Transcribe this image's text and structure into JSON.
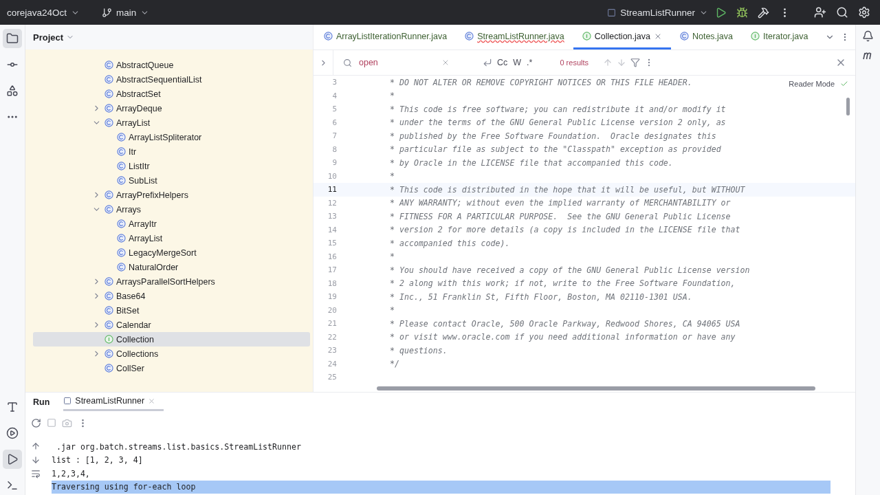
{
  "title_bar": {
    "project": "corejava24Oct",
    "branch": "main",
    "run_config": "StreamListRunner"
  },
  "project_panel": {
    "title": "Project",
    "tree": [
      {
        "label": "AbstractQueue",
        "kind": "class",
        "selected": false
      },
      {
        "label": "AbstractSequentialList",
        "kind": "class",
        "selected": false
      },
      {
        "label": "AbstractSet",
        "kind": "class",
        "selected": false
      },
      {
        "label": "ArrayDeque",
        "kind": "class",
        "selected": false,
        "expanded": false
      },
      {
        "label": "ArrayList",
        "kind": "class",
        "selected": false,
        "expanded": true,
        "children": [
          {
            "label": "ArrayListSpliterator",
            "kind": "class",
            "selected": false
          },
          {
            "label": "Itr",
            "kind": "class",
            "selected": false
          },
          {
            "label": "ListItr",
            "kind": "class",
            "selected": false
          },
          {
            "label": "SubList",
            "kind": "class",
            "selected": false
          }
        ]
      },
      {
        "label": "ArrayPrefixHelpers",
        "kind": "class",
        "selected": false,
        "expanded": false
      },
      {
        "label": "Arrays",
        "kind": "class",
        "selected": false,
        "expanded": true,
        "children": [
          {
            "label": "ArrayItr",
            "kind": "class",
            "selected": false
          },
          {
            "label": "ArrayList",
            "kind": "class",
            "selected": false
          },
          {
            "label": "LegacyMergeSort",
            "kind": "class",
            "selected": false
          },
          {
            "label": "NaturalOrder",
            "kind": "class",
            "selected": false
          }
        ]
      },
      {
        "label": "ArraysParallelSortHelpers",
        "kind": "class",
        "selected": false,
        "expanded": false
      },
      {
        "label": "Base64",
        "kind": "class",
        "selected": false,
        "expanded": false
      },
      {
        "label": "BitSet",
        "kind": "class",
        "selected": false
      },
      {
        "label": "Calendar",
        "kind": "class",
        "selected": false,
        "expanded": false
      },
      {
        "label": "Collection",
        "kind": "interface",
        "selected": true
      },
      {
        "label": "Collections",
        "kind": "class",
        "selected": false,
        "expanded": false
      },
      {
        "label": "CollSer",
        "kind": "class",
        "selected": false
      }
    ]
  },
  "editor_tabs": [
    {
      "label": "ArrayListIterationRunner.java",
      "kind": "class",
      "selected": false,
      "error": false
    },
    {
      "label": "StreamListRunner.java",
      "kind": "class",
      "selected": false,
      "error": true
    },
    {
      "label": "Collection.java",
      "kind": "interface",
      "selected": true,
      "error": false
    },
    {
      "label": "Notes.java",
      "kind": "class",
      "selected": false,
      "error": false
    },
    {
      "label": "Iterator.java",
      "kind": "interface",
      "selected": false,
      "error": false
    }
  ],
  "find_bar": {
    "value": "open",
    "options": [
      "Cc",
      "W",
      ".*"
    ],
    "results": "0 results"
  },
  "reader_mode": "Reader Mode",
  "code_lines": [
    {
      "number": "3",
      "text": "* DO NOT ALTER OR REMOVE COPYRIGHT NOTICES OR THIS FILE HEADER.",
      "current": false
    },
    {
      "number": "4",
      "text": "*",
      "current": false
    },
    {
      "number": "5",
      "text": "* This code is free software; you can redistribute it and/or modify it",
      "current": false
    },
    {
      "number": "6",
      "text": "* under the terms of the GNU General Public License version 2 only, as",
      "current": false
    },
    {
      "number": "7",
      "text": "* published by the Free Software Foundation.  Oracle designates this",
      "current": false
    },
    {
      "number": "8",
      "text": "* particular file as subject to the \"Classpath\" exception as provided",
      "current": false
    },
    {
      "number": "9",
      "text": "* by Oracle in the LICENSE file that accompanied this code.",
      "current": false
    },
    {
      "number": "10",
      "text": "*",
      "current": false
    },
    {
      "number": "11",
      "text": "* This code is distributed in the hope that it will be useful, but WITHOUT",
      "current": true
    },
    {
      "number": "12",
      "text": "* ANY WARRANTY; without even the implied warranty of MERCHANTABILITY or",
      "current": false
    },
    {
      "number": "13",
      "text": "* FITNESS FOR A PARTICULAR PURPOSE.  See the GNU General Public License",
      "current": false
    },
    {
      "number": "14",
      "text": "* version 2 for more details (a copy is included in the LICENSE file that",
      "current": false
    },
    {
      "number": "15",
      "text": "* accompanied this code).",
      "current": false
    },
    {
      "number": "16",
      "text": "*",
      "current": false
    },
    {
      "number": "17",
      "text": "* You should have received a copy of the GNU General Public License version",
      "current": false
    },
    {
      "number": "18",
      "text": "* 2 along with this work; if not, write to the Free Software Foundation,",
      "current": false
    },
    {
      "number": "19",
      "text": "* Inc., 51 Franklin St, Fifth Floor, Boston, MA 02110-1301 USA.",
      "current": false
    },
    {
      "number": "20",
      "text": "*",
      "current": false
    },
    {
      "number": "21",
      "text": "* Please contact Oracle, 500 Oracle Parkway, Redwood Shores, CA 94065 USA",
      "current": false
    },
    {
      "number": "22",
      "text": "* or visit www.oracle.com if you need additional information or have any",
      "current": false
    },
    {
      "number": "23",
      "text": "* questions.",
      "current": false
    },
    {
      "number": "24",
      "text": "*/",
      "current": false
    },
    {
      "number": "25",
      "current": false
    }
  ],
  "run_panel": {
    "title": "Run",
    "tab": "StreamListRunner",
    "console": [
      {
        "text": " .jar org.batch.streams.list.basics.StreamListRunner",
        "selected": false
      },
      {
        "text": "list : [1, 2, 3, 4]",
        "selected": false
      },
      {
        "text": "1,2,3,4,",
        "selected": false
      },
      {
        "text": "Traversing using for-each loop",
        "selected": true
      }
    ]
  }
}
